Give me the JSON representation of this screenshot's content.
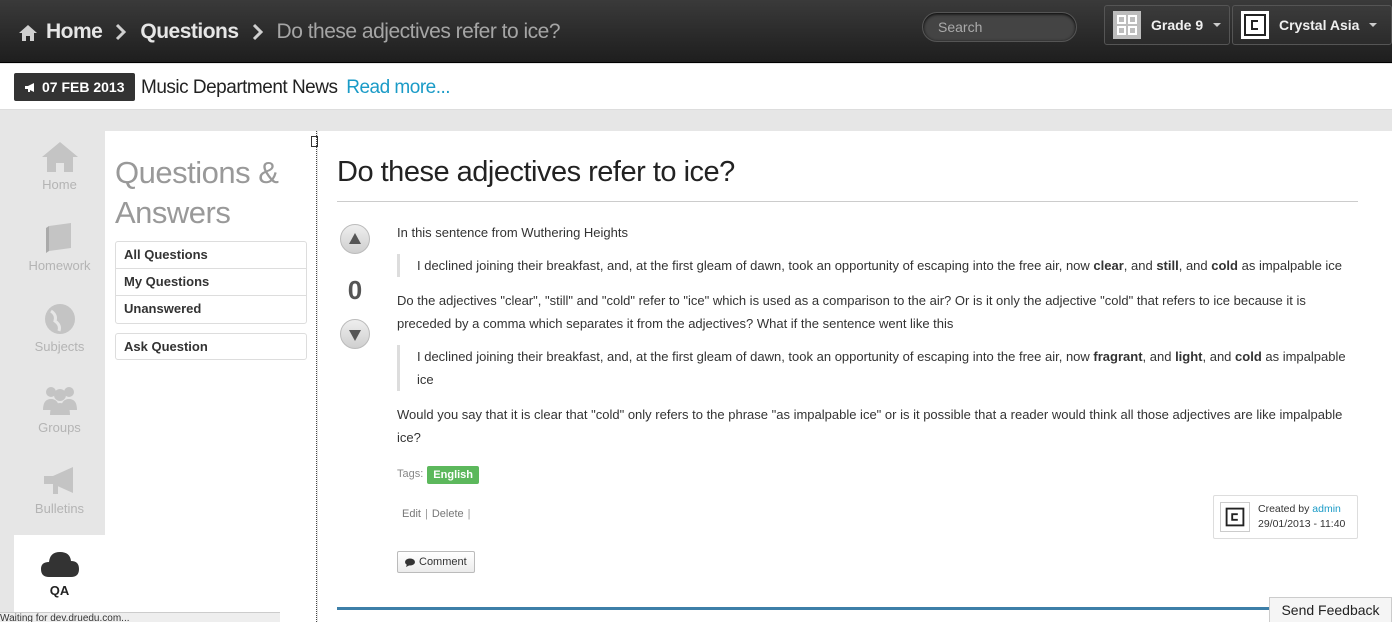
{
  "header": {
    "breadcrumb": [
      "Home",
      "Questions",
      "Do these adjectives refer to ice?"
    ],
    "search_placeholder": "Search",
    "grade_label": "Grade 9",
    "user_label": "Crystal Asia"
  },
  "news": {
    "date": "07 FEB 2013",
    "title": "Music Department News",
    "more": "Read more..."
  },
  "leftnav": {
    "items": [
      {
        "label": "Home",
        "icon": "home-icon"
      },
      {
        "label": "Homework",
        "icon": "book-icon"
      },
      {
        "label": "Subjects",
        "icon": "globe-icon"
      },
      {
        "label": "Groups",
        "icon": "people-icon"
      },
      {
        "label": "Bulletins",
        "icon": "megaphone-icon"
      },
      {
        "label": "QA",
        "icon": "cloud-icon"
      }
    ]
  },
  "panel": {
    "title": "Questions & Answers",
    "menu": [
      "All Questions",
      "My Questions",
      "Unanswered"
    ],
    "ask": "Ask Question"
  },
  "question": {
    "title": "Do these adjectives refer to ice?",
    "votes": "0",
    "intro": "In this sentence from Wuthering Heights",
    "quote1": {
      "pre": "I declined joining their breakfast, and, at the first gleam of dawn, took an opportunity of escaping into the free air, now ",
      "b1": "clear",
      "m1": ", and ",
      "b2": "still",
      "m2": ", and ",
      "b3": "cold",
      "post": " as impalpable ice"
    },
    "para2": "Do the adjectives \"clear\", \"still\" and \"cold\" refer to \"ice\" which is used as a comparison to the air? Or is it only the adjective \"cold\" that refers to ice because it is preceded by a comma which separates it from the adjectives? What if the sentence went like this",
    "quote2": {
      "pre": "I declined joining their breakfast, and, at the first gleam of dawn, took an opportunity of escaping into the free air, now ",
      "b1": "fragrant",
      "m1": ", and ",
      "b2": "light",
      "m2": ", and ",
      "b3": "cold",
      "post": " as impalpable ice"
    },
    "para3": "Would you say that it is clear that \"cold\" only refers to the phrase \"as impalpable ice\" or is it possible that a reader would think all those adjectives are like impalpable ice?",
    "tags_label": "Tags:",
    "tag": "English",
    "edit": "Edit",
    "delete": "Delete",
    "created_by_label": "Created by",
    "author": "admin",
    "created_at": "29/01/2013 - 11:40",
    "comment": "Comment"
  },
  "footer": {
    "feedback": "Send Feedback",
    "status": "Waiting for dev.druedu.com..."
  },
  "colors": {
    "accent": "#1a9bc7",
    "tag": "#5cb85c",
    "topbar": "#2a2a2a"
  }
}
